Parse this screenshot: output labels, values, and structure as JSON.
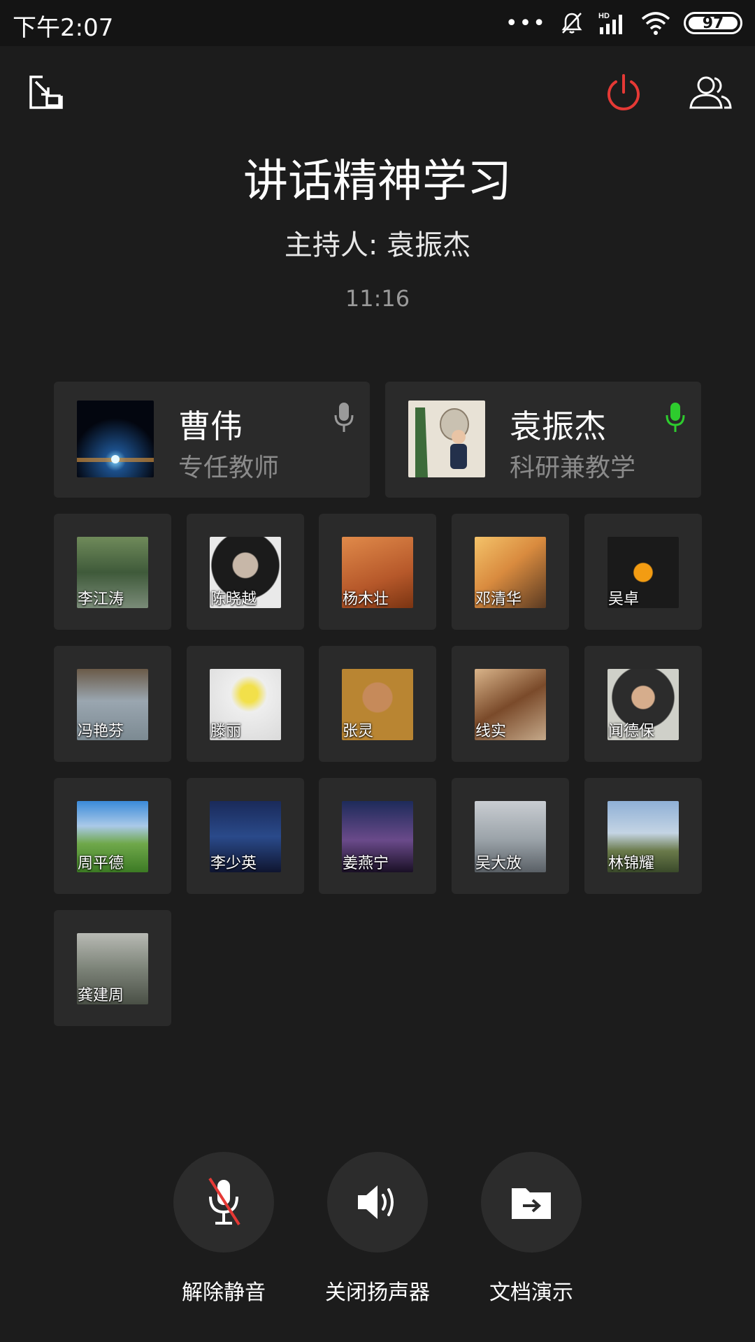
{
  "status_bar": {
    "time": "下午2:07",
    "battery": "97"
  },
  "header": {
    "title": "讲话精神学习",
    "host_label": "主持人: 袁振杰",
    "elapsed": "11:16"
  },
  "speakers": [
    {
      "name": "曹伟",
      "role": "专任教师",
      "mic_color": "#9a9a9a"
    },
    {
      "name": "袁振杰",
      "role": "科研兼教学",
      "mic_color": "#2ecc2e"
    }
  ],
  "participants": [
    {
      "name": "李江涛"
    },
    {
      "name": "陈晓越"
    },
    {
      "name": "杨木壮"
    },
    {
      "name": "邓清华"
    },
    {
      "name": "吴卓"
    },
    {
      "name": "冯艳芬"
    },
    {
      "name": "滕丽"
    },
    {
      "name": "张灵"
    },
    {
      "name": "线实"
    },
    {
      "name": "闻德保"
    },
    {
      "name": "周平德"
    },
    {
      "name": "李少英"
    },
    {
      "name": "姜燕宁"
    },
    {
      "name": "吴大放"
    },
    {
      "name": "林锦耀"
    },
    {
      "name": "龚建周"
    }
  ],
  "controls": {
    "unmute_label": "解除静音",
    "speaker_label": "关闭扬声器",
    "doc_label": "文档演示"
  },
  "colors": {
    "power_red": "#e53935",
    "mic_active_green": "#2ecc2e"
  },
  "icons": {
    "minimize": "minimize-window-icon",
    "power": "power-icon",
    "members": "members-icon"
  }
}
